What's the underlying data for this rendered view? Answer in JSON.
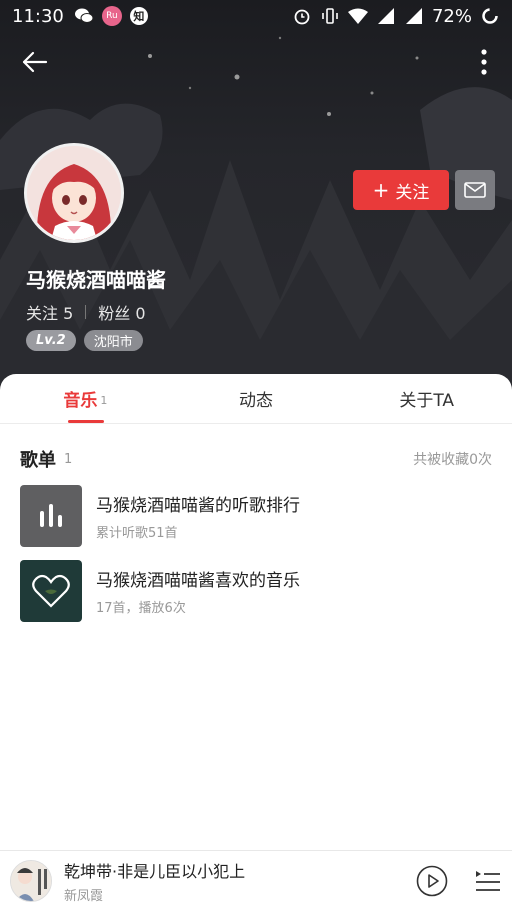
{
  "status_bar": {
    "time": "11:30",
    "app_badge_text": "Ru",
    "app_badge_2": "知",
    "battery": "72%"
  },
  "profile": {
    "nickname": "马猴烧酒喵喵酱",
    "follow_label": "关注",
    "following_label": "关注",
    "following_count": "5",
    "fans_label": "粉丝",
    "fans_count": "0",
    "level": "Lv.2",
    "city": "沈阳市"
  },
  "tabs": [
    {
      "label": "音乐",
      "count": "1"
    },
    {
      "label": "动态"
    },
    {
      "label": "关于TA"
    }
  ],
  "playlists_section": {
    "title": "歌单",
    "count": "1",
    "collected": "共被收藏0次"
  },
  "playlists": [
    {
      "title": "马猴烧酒喵喵酱的听歌排行",
      "sub": "累计听歌51首",
      "icon": "bar-chart-icon",
      "color": "#5f5f61"
    },
    {
      "title": "马猴烧酒喵喵酱喜欢的音乐",
      "sub": "17首，播放6次",
      "icon": "heart-icon",
      "color": "#1f3a38"
    }
  ],
  "player": {
    "song": "乾坤带·非是儿臣以小犯上",
    "artist": "新凤霞"
  },
  "colors": {
    "accent": "#e93a3a",
    "header_bg": "#25262b"
  }
}
